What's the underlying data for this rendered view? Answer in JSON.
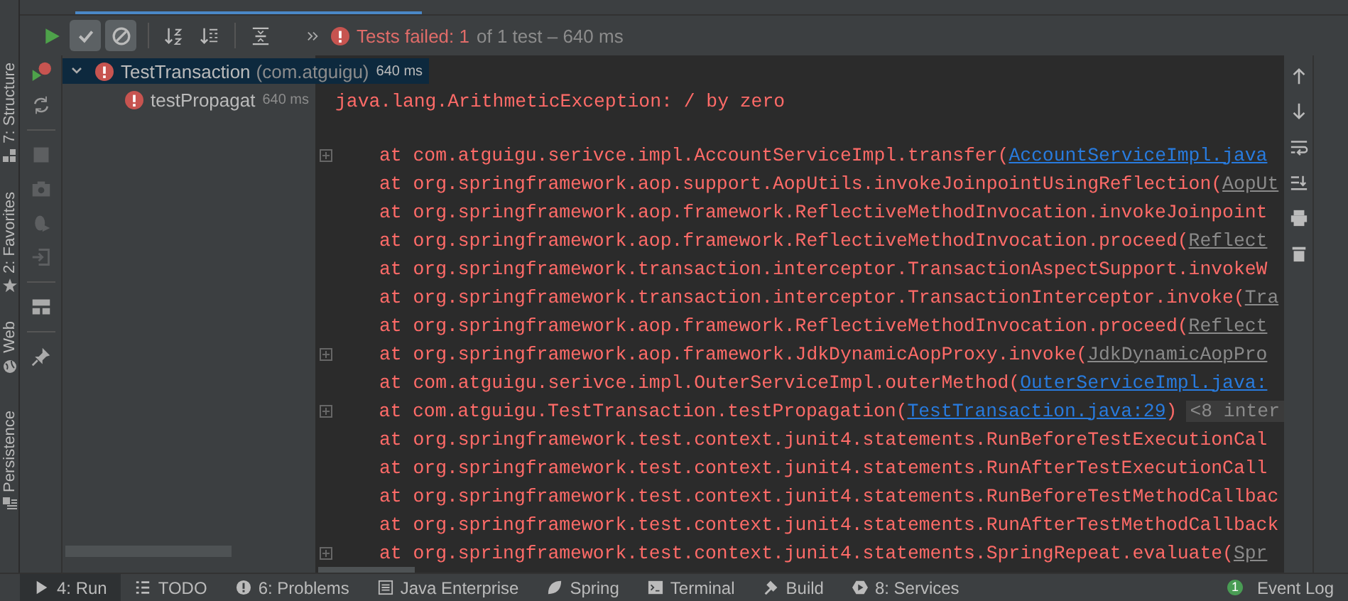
{
  "side_tabs": [
    {
      "kind": "structure",
      "label": "7: Structure"
    },
    {
      "kind": "favorites",
      "label": "2: Favorites"
    },
    {
      "kind": "web",
      "label": "Web"
    },
    {
      "kind": "persistence",
      "label": "Persistence"
    }
  ],
  "toolbar": {
    "toggles": [
      {
        "kind": "passed",
        "on": true
      },
      {
        "kind": "ignored",
        "on": true
      }
    ],
    "status": {
      "failed": "Tests failed: 1",
      "rest": "of 1 test – 640 ms"
    }
  },
  "tree": [
    {
      "name": "TestTransaction",
      "package": "(com.atguigu)",
      "time": "640 ms",
      "selected": true,
      "expanded": true,
      "children": [
        {
          "name": "testPropagat",
          "time": "640 ms",
          "selected": false
        }
      ]
    }
  ],
  "console": {
    "exception": "java.lang.ArithmeticException: / by zero",
    "lines": [
      {
        "fold": true,
        "text": "at com.atguigu.serivce.impl.AccountServiceImpl.transfer(",
        "link": "AccountServiceImpl.java",
        "kind": "project"
      },
      {
        "fold": false,
        "text": "at org.springframework.aop.support.AopUtils.invokeJoinpointUsingReflection(",
        "link": "AopUt",
        "kind": "library"
      },
      {
        "fold": false,
        "text": "at org.springframework.aop.framework.ReflectiveMethodInvocation.invokeJoinpoint"
      },
      {
        "fold": false,
        "text": "at org.springframework.aop.framework.ReflectiveMethodInvocation.proceed(",
        "link": "Reflect",
        "kind": "library"
      },
      {
        "fold": false,
        "text": "at org.springframework.transaction.interceptor.TransactionAspectSupport.invokeW"
      },
      {
        "fold": false,
        "text": "at org.springframework.transaction.interceptor.TransactionInterceptor.invoke(",
        "link": "Tra",
        "kind": "library"
      },
      {
        "fold": false,
        "text": "at org.springframework.aop.framework.ReflectiveMethodInvocation.proceed(",
        "link": "Reflect",
        "kind": "library"
      },
      {
        "fold": true,
        "text": "at org.springframework.aop.framework.JdkDynamicAopProxy.invoke(",
        "link": "JdkDynamicAopPro",
        "kind": "library"
      },
      {
        "fold": false,
        "text": "at com.atguigu.serivce.impl.OuterServiceImpl.outerMethod(",
        "link": "OuterServiceImpl.java:",
        "kind": "project"
      },
      {
        "fold": true,
        "text": "at com.atguigu.TestTransaction.testPropagation(",
        "link": "TestTransaction.java:29",
        "kind": "project",
        "after": ")",
        "note": "<8 inter"
      },
      {
        "fold": false,
        "text": "at org.springframework.test.context.junit4.statements.RunBeforeTestExecutionCal"
      },
      {
        "fold": false,
        "text": "at org.springframework.test.context.junit4.statements.RunAfterTestExecutionCall"
      },
      {
        "fold": false,
        "text": "at org.springframework.test.context.junit4.statements.RunBeforeTestMethodCallbac"
      },
      {
        "fold": false,
        "text": "at org.springframework.test.context.junit4.statements.RunAfterTestMethodCallback"
      },
      {
        "fold": true,
        "text": "at org.springframework.test.context.junit4.statements.SpringRepeat.evaluate(",
        "link": "Spr",
        "kind": "library"
      }
    ]
  },
  "bottom_tabs": [
    {
      "kind": "run",
      "label": "4: Run",
      "selected": true
    },
    {
      "kind": "todo",
      "label": "TODO",
      "selected": false
    },
    {
      "kind": "problems",
      "label": "6: Problems",
      "selected": false
    },
    {
      "kind": "javaee",
      "label": "Java Enterprise",
      "selected": false
    },
    {
      "kind": "spring",
      "label": "Spring",
      "selected": false
    },
    {
      "kind": "terminal",
      "label": "Terminal",
      "selected": false
    },
    {
      "kind": "build",
      "label": "Build",
      "selected": false
    },
    {
      "kind": "services",
      "label": "8: Services",
      "selected": false
    }
  ],
  "event_log": {
    "label": "Event Log",
    "count": "1"
  }
}
